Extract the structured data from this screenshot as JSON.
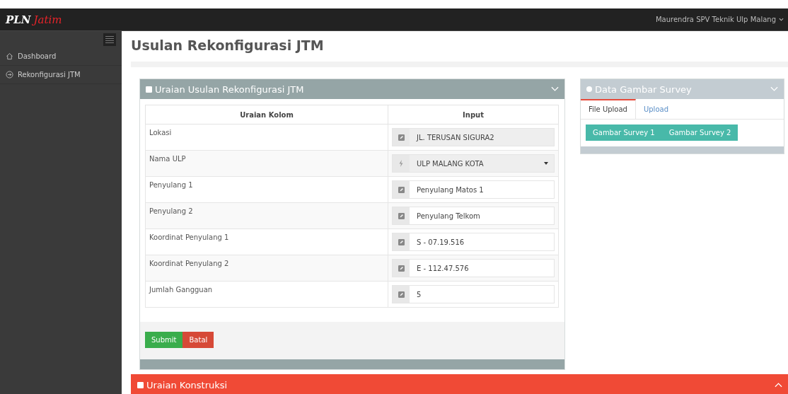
{
  "brand": {
    "part_1": "PLN",
    "part_2": "Jatim"
  },
  "user_menu": {
    "label": "Maurendra SPV Teknik Ulp Malang"
  },
  "sidebar": {
    "items": [
      {
        "label": "Dashboard"
      },
      {
        "label": "Rekonfigurasi JTM"
      }
    ]
  },
  "page_title": "Usulan Rekonfigurasi JTM",
  "form_panel": {
    "title": "Uraian Usulan Rekonfigurasi JTM",
    "expanded": true,
    "table": {
      "columns": [
        "Uraian Kolom",
        "Input"
      ],
      "rows": [
        {
          "label": "Lokasi",
          "kind": "readonly",
          "value": "JL. TERUSAN SIGURA2"
        },
        {
          "label": "Nama ULP",
          "kind": "select",
          "value": "ULP MALANG KOTA"
        },
        {
          "label": "Penyulang 1",
          "kind": "text",
          "value": "Penyulang Matos 1"
        },
        {
          "label": "Penyulang 2",
          "kind": "text",
          "value": "Penyulang Telkom"
        },
        {
          "label": "Koordinat Penyulang 1",
          "kind": "text",
          "value": "S - 07.19.516"
        },
        {
          "label": "Koordinat Penyulang 2",
          "kind": "text",
          "value": "E - 112.47.576"
        },
        {
          "label": "Jumlah Gangguan",
          "kind": "text",
          "value": "5"
        }
      ]
    },
    "buttons": [
      {
        "label": "Submit",
        "kind": "success"
      },
      {
        "label": "Batal",
        "kind": "danger"
      }
    ]
  },
  "survey_panel": {
    "title": "Data Gambar Survey",
    "expanded": true,
    "tabs": [
      {
        "label": "File Upload",
        "selected": true
      },
      {
        "label": "Upload",
        "selected": false
      }
    ],
    "buttons": [
      "Gambar Survey 1",
      "Gambar Survey 2"
    ]
  },
  "construction_panel": {
    "title": "Uraian Konstruksi",
    "expanded": false
  }
}
